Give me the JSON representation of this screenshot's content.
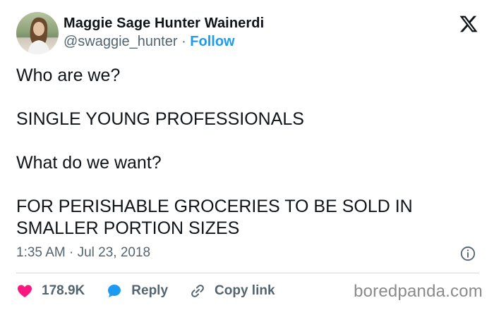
{
  "author": {
    "display_name": "Maggie Sage Hunter Wainerdi",
    "handle": "@swaggie_hunter",
    "separator": " · ",
    "follow_label": "Follow"
  },
  "tweet": {
    "lines": [
      "Who are we?",
      "SINGLE YOUNG PROFESSIONALS",
      "What do we want?",
      "FOR PERISHABLE GROCERIES TO BE SOLD IN SMALLER PORTION SIZES"
    ],
    "timestamp": "1:35 AM · Jul 23, 2018"
  },
  "actions": {
    "like_count": "178.9K",
    "reply_label": "Reply",
    "copy_link_label": "Copy link"
  },
  "watermark": "boredpanda.com",
  "colors": {
    "accent": "#1d9bf0",
    "like": "#f91880",
    "muted": "#536471"
  },
  "icons": {
    "logo": "x-logo-icon",
    "info": "info-icon",
    "like": "heart-icon",
    "reply": "speech-bubble-icon",
    "copy": "link-icon"
  }
}
